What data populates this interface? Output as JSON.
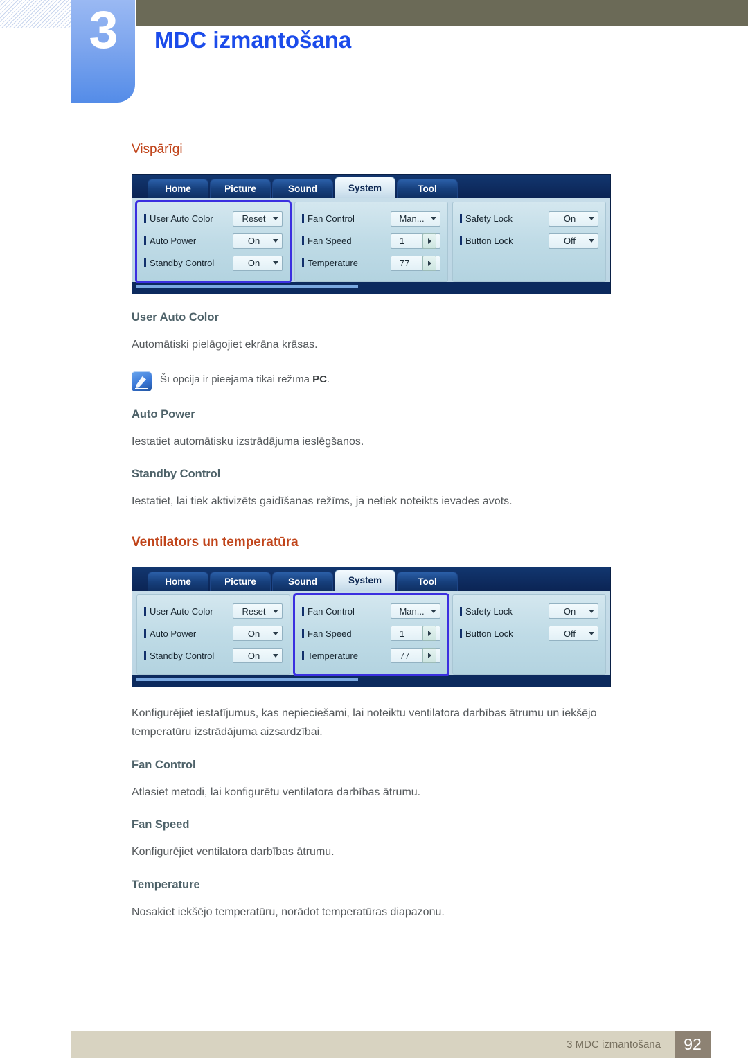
{
  "header": {
    "chapter_number": "3",
    "chapter_title": "MDC izmantošana"
  },
  "sections": [
    {
      "heading": "Vispārīgi",
      "subsections": [
        {
          "title": "User Auto Color",
          "text": "Automātiski pielāgojiet ekrāna krāsas."
        },
        {
          "title": "Auto Power",
          "text": "Iestatiet automātisku izstrādājuma ieslēgšanos."
        },
        {
          "title": "Standby Control",
          "text": "Iestatiet, lai tiek aktivizēts gaidīšanas režīms, ja netiek noteikts ievades avots."
        }
      ],
      "note": {
        "icon": "note-pencil-icon",
        "text_before": "Šī opcija ir pieejama tikai režīmā ",
        "text_bold": "PC",
        "text_after": "."
      }
    },
    {
      "heading": "Ventilators un temperatūra",
      "intro": "Konfigurējiet iestatījumus, kas nepieciešami, lai noteiktu ventilatora darbības ātrumu un iekšējo temperatūru izstrādājuma aizsardzībai.",
      "subsections": [
        {
          "title": "Fan Control",
          "text": "Atlasiet metodi, lai konfigurētu ventilatora darbības ātrumu."
        },
        {
          "title": "Fan Speed",
          "text": "Konfigurējiet ventilatora darbības ātrumu."
        },
        {
          "title": "Temperature",
          "text": "Nosakiet iekšējo temperatūru, norādot temperatūras diapazonu."
        }
      ]
    }
  ],
  "mdc_screenshots": [
    {
      "id": "mdc-general",
      "highlight_panel": 0,
      "tabs": [
        {
          "label": "Home",
          "active": false
        },
        {
          "label": "Picture",
          "active": false
        },
        {
          "label": "Sound",
          "active": false
        },
        {
          "label": "System",
          "active": true
        },
        {
          "label": "Tool",
          "active": false
        }
      ],
      "panels": [
        {
          "name": "general-panel",
          "rows": [
            {
              "label": "User Auto Color",
              "value": "Reset",
              "control": "dropdown"
            },
            {
              "label": "Auto Power",
              "value": "On",
              "control": "dropdown"
            },
            {
              "label": "Standby Control",
              "value": "On",
              "control": "dropdown"
            }
          ]
        },
        {
          "name": "fan-temperature-panel",
          "rows": [
            {
              "label": "Fan Control",
              "value": "Man...",
              "control": "dropdown"
            },
            {
              "label": "Fan Speed",
              "value": "1",
              "control": "spinner"
            },
            {
              "label": "Temperature",
              "value": "77",
              "control": "spinner"
            }
          ]
        },
        {
          "name": "lock-panel",
          "rows": [
            {
              "label": "Safety Lock",
              "value": "On",
              "control": "dropdown"
            },
            {
              "label": "Button Lock",
              "value": "Off",
              "control": "dropdown"
            }
          ]
        }
      ]
    },
    {
      "id": "mdc-fan",
      "highlight_panel": 1,
      "tabs": [
        {
          "label": "Home",
          "active": false
        },
        {
          "label": "Picture",
          "active": false
        },
        {
          "label": "Sound",
          "active": false
        },
        {
          "label": "System",
          "active": true
        },
        {
          "label": "Tool",
          "active": false
        }
      ],
      "panels": [
        {
          "name": "general-panel",
          "rows": [
            {
              "label": "User Auto Color",
              "value": "Reset",
              "control": "dropdown"
            },
            {
              "label": "Auto Power",
              "value": "On",
              "control": "dropdown"
            },
            {
              "label": "Standby Control",
              "value": "On",
              "control": "dropdown"
            }
          ]
        },
        {
          "name": "fan-temperature-panel",
          "rows": [
            {
              "label": "Fan Control",
              "value": "Man...",
              "control": "dropdown"
            },
            {
              "label": "Fan Speed",
              "value": "1",
              "control": "spinner"
            },
            {
              "label": "Temperature",
              "value": "77",
              "control": "spinner"
            }
          ]
        },
        {
          "name": "lock-panel",
          "rows": [
            {
              "label": "Safety Lock",
              "value": "On",
              "control": "dropdown"
            },
            {
              "label": "Button Lock",
              "value": "Off",
              "control": "dropdown"
            }
          ]
        }
      ]
    }
  ],
  "footer": {
    "text": "3 MDC izmantošana",
    "page_number": "92"
  },
  "colors": {
    "heading_orange": "#c0441a",
    "chapter_blue": "#1b4bea",
    "olive_bar": "#6b6a57",
    "footer_bar": "#d8d3c1",
    "footer_page_box": "#8d8273",
    "highlight_border": "#3b2fe0"
  }
}
